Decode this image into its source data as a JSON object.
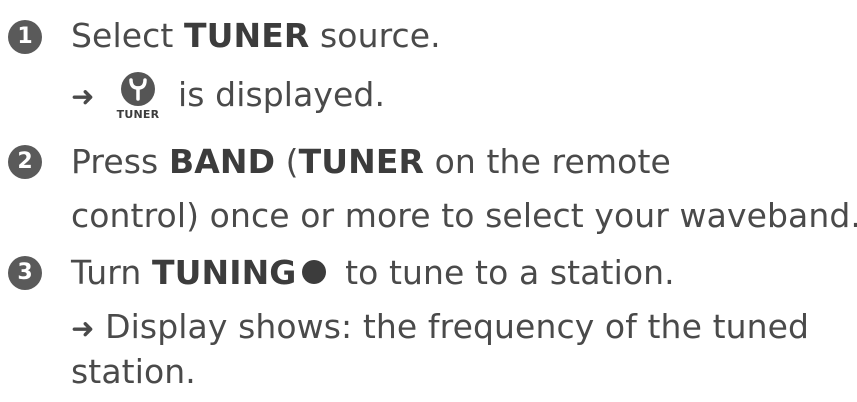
{
  "steps": [
    {
      "number": "1",
      "line1": {
        "pre": "Select ",
        "bold": "TUNER",
        "post": " source."
      },
      "line2": {
        "arrow": "➜",
        "icon_label": "TUNER",
        "post": "is displayed."
      }
    },
    {
      "number": "2",
      "line1": {
        "pre": "Press ",
        "bold1": "BAND",
        "mid": " (",
        "bold2": "TUNER",
        "post": " on the remote"
      },
      "line2": {
        "text": "control) once or more to select your waveband."
      }
    },
    {
      "number": "3",
      "line1": {
        "pre": "Turn ",
        "bold": "TUNING",
        "post": " to tune to a station."
      },
      "line2": {
        "arrow": "➜",
        "text": " Display shows:  the frequency of the tuned"
      },
      "line3": {
        "text": "station."
      }
    }
  ],
  "icons": {
    "tuner_icon": "antenna-icon",
    "tuning_knob": "knob-icon",
    "arrow": "arrow-right-icon"
  },
  "colors": {
    "text": "#4a4a4a",
    "badge": "#5a5a5a"
  }
}
